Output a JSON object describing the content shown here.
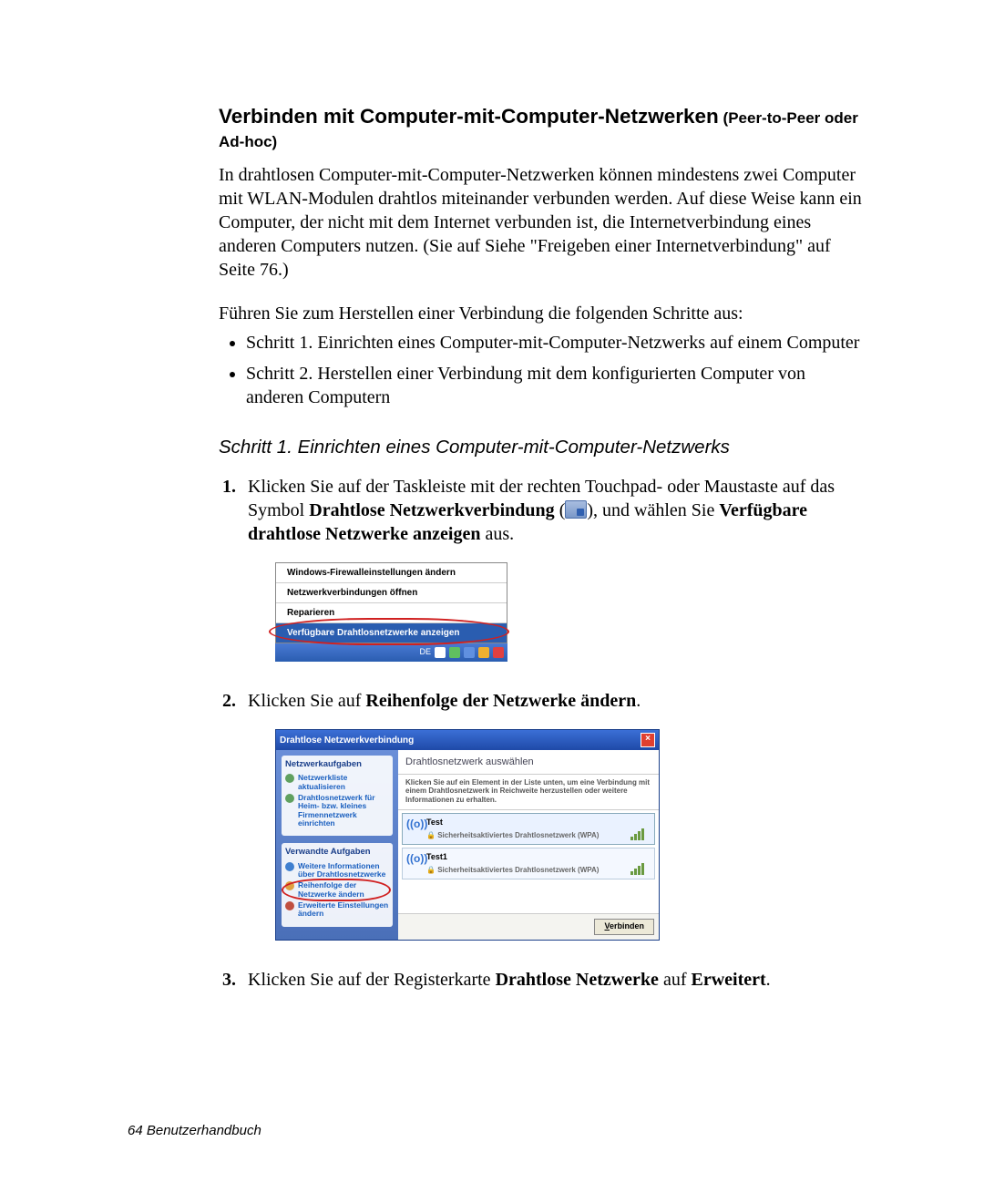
{
  "heading_main": "Verbinden mit Computer-mit-Computer-Netzwerken",
  "heading_sub": " (Peer-to-Peer oder Ad-hoc)",
  "intro_para": "In drahtlosen Computer-mit-Computer-Netzwerken können mindestens zwei Computer mit WLAN-Modulen drahtlos miteinander verbunden werden. Auf diese Weise kann ein Computer, der nicht mit dem Internet verbunden ist, die Internetverbindung eines anderen Computers nutzen. (Sie auf Siehe \"Freigeben einer Internetverbindung\" auf Seite 76.)",
  "intro_para2": "Führen Sie zum Herstellen einer Verbindung die folgenden Schritte aus:",
  "bullets": [
    "Schritt 1. Einrichten eines Computer-mit-Computer-Netzwerks auf einem Computer",
    "Schritt 2. Herstellen einer Verbindung mit dem konfigurierten Computer von anderen Computern"
  ],
  "subhead": "Schritt 1. Einrichten eines Computer-mit-Computer-Netzwerks",
  "steps": {
    "1": {
      "pre": "Klicken Sie auf der Taskleiste mit der rechten Touchpad- oder Maustaste auf das Symbol ",
      "b1": "Drahtlose Netzwerkverbindung",
      "mid": " (",
      "mid2": "), und wählen Sie ",
      "b2": "Verfügbare drahtlose Netzwerke anzeigen",
      "post": " aus."
    },
    "2": {
      "pre": "Klicken Sie auf ",
      "b1": "Reihenfolge der Netzwerke ändern",
      "post": "."
    },
    "3": {
      "pre": "Klicken Sie auf der Registerkarte ",
      "b1": "Drahtlose Netzwerke",
      "mid": " auf ",
      "b2": "Erweitert",
      "post": "."
    }
  },
  "shot1": {
    "menu": [
      "Windows-Firewalleinstellungen ändern",
      "Netzwerkverbindungen öffnen",
      "Reparieren"
    ],
    "menu_highlight": "Verfügbare Drahtlosnetzwerke anzeigen",
    "taskbar_lang": "DE"
  },
  "shot2": {
    "title": "Drahtlose Netzwerkverbindung",
    "sidebar": {
      "section1_title": "Netzwerkaufgaben",
      "section1_links": [
        "Netzwerkliste aktualisieren",
        "Drahtlosnetzwerk für Heim- bzw. kleines Firmennetzwerk einrichten"
      ],
      "section2_title": "Verwandte Aufgaben",
      "section2_links": [
        "Weitere Informationen über Drahtlosnetzwerke",
        "Reihenfolge der Netzwerke ändern",
        "Erweiterte Einstellungen ändern"
      ]
    },
    "main_head": "Drahtlosnetzwerk auswählen",
    "main_sub": "Klicken Sie auf ein Element in der Liste unten, um eine Verbindung mit einem Drahtlosnetzwerk in Reichweite herzustellen oder weitere Informationen zu erhalten.",
    "networks": [
      {
        "name": "Test",
        "sec": "Sicherheitsaktiviertes Drahtlosnetzwerk (WPA)"
      },
      {
        "name": "Test1",
        "sec": "Sicherheitsaktiviertes Drahtlosnetzwerk (WPA)"
      }
    ],
    "connect_button": "Verbinden"
  },
  "footer": "64  Benutzerhandbuch"
}
